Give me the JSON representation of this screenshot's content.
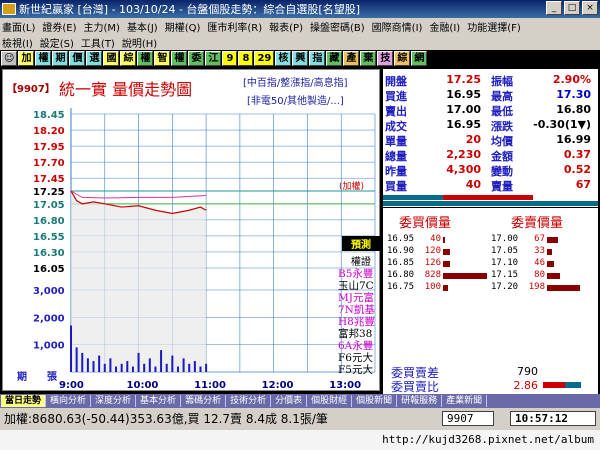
{
  "window": {
    "title": "新世紀贏家 [台灣] - 103/10/24 - 台盤個股走勢：綜合自選股[名望股]",
    "buttons": [
      "_",
      "□",
      "×"
    ]
  },
  "menu": {
    "row1": [
      "畫面(L)",
      "證券(E)",
      "主力(M)",
      "基本(J)",
      "期權(Q)",
      "匯市利率(R)",
      "報表(P)",
      "操盤密碼(B)",
      "國際商情(I)",
      "金融(I)",
      "功能選擇(F)"
    ],
    "row2": [
      "檢視(I)",
      "設定(S)",
      "工具(T)",
      "說明(H)"
    ]
  },
  "toolbar": {
    "buttons": [
      "☺",
      "加",
      "權",
      "期",
      "價",
      "選",
      "國",
      "綜",
      "權",
      "智",
      "權",
      "委",
      "江",
      "9",
      "8",
      "29",
      "核",
      "興",
      "指",
      "藏",
      "產",
      "棄",
      "技",
      "綜",
      "網"
    ]
  },
  "chart": {
    "stock_code": "【9907】",
    "title": "統一實  量價走勢圖",
    "sub1": "[中百指/整漲指/高息指]",
    "sub2": "[非電50/其他製造/...]",
    "annotation": "(加權)",
    "volume_axis_label": "張",
    "period_label": "期",
    "price_ticks": [
      "18.45",
      "18.20",
      "17.95",
      "17.70",
      "17.45",
      "17.25",
      "17.05",
      "16.80",
      "16.55",
      "16.30",
      "16.05"
    ],
    "volume_ticks": [
      "3,000",
      "2,000",
      "1,000"
    ],
    "time_ticks": [
      "9:00",
      "10:00",
      "11:00",
      "12:00",
      "13:00"
    ]
  },
  "chart_data": {
    "type": "line",
    "title": "統一實  量價走勢圖",
    "ylim": [
      16.05,
      18.45
    ],
    "reference_price": 17.25,
    "price_series": [
      {
        "t": "9:00",
        "v": 17.25
      },
      {
        "t": "9:05",
        "v": 17.1
      },
      {
        "t": "9:10",
        "v": 17.05
      },
      {
        "t": "9:20",
        "v": 17.08
      },
      {
        "t": "9:30",
        "v": 17.05
      },
      {
        "t": "9:45",
        "v": 17.0
      },
      {
        "t": "10:00",
        "v": 17.02
      },
      {
        "t": "10:15",
        "v": 16.95
      },
      {
        "t": "10:30",
        "v": 16.9
      },
      {
        "t": "10:45",
        "v": 16.95
      },
      {
        "t": "10:55",
        "v": 17.0
      },
      {
        "t": "11:00",
        "v": 16.95
      }
    ],
    "index_series": [
      {
        "t": "9:00",
        "v": 17.25
      },
      {
        "t": "9:10",
        "v": 17.15
      },
      {
        "t": "9:30",
        "v": 17.14
      },
      {
        "t": "10:00",
        "v": 17.15
      },
      {
        "t": "10:30",
        "v": 17.15
      },
      {
        "t": "11:00",
        "v": 17.18
      }
    ],
    "volume": [
      {
        "t": "9:00",
        "v": 1700
      },
      {
        "t": "9:05",
        "v": 900
      },
      {
        "t": "9:10",
        "v": 700
      },
      {
        "t": "9:15",
        "v": 500
      },
      {
        "t": "9:20",
        "v": 400
      },
      {
        "t": "9:25",
        "v": 600
      },
      {
        "t": "9:30",
        "v": 300
      },
      {
        "t": "9:35",
        "v": 500
      },
      {
        "t": "9:40",
        "v": 200
      },
      {
        "t": "9:45",
        "v": 300
      },
      {
        "t": "9:50",
        "v": 400
      },
      {
        "t": "9:55",
        "v": 200
      },
      {
        "t": "10:00",
        "v": 700
      },
      {
        "t": "10:05",
        "v": 300
      },
      {
        "t": "10:10",
        "v": 500
      },
      {
        "t": "10:15",
        "v": 200
      },
      {
        "t": "10:20",
        "v": 800
      },
      {
        "t": "10:25",
        "v": 300
      },
      {
        "t": "10:30",
        "v": 600
      },
      {
        "t": "10:35",
        "v": 200
      },
      {
        "t": "10:40",
        "v": 500
      },
      {
        "t": "10:45",
        "v": 300
      },
      {
        "t": "10:50",
        "v": 400
      },
      {
        "t": "10:55",
        "v": 200
      },
      {
        "t": "11:00",
        "v": 300
      }
    ],
    "vlim": [
      0,
      3000
    ],
    "time_range": [
      "9:00",
      "13:30"
    ],
    "grid": true
  },
  "quote": {
    "rows_left": [
      {
        "label": "開盤",
        "value": "17.25",
        "color": "#cc0000"
      },
      {
        "label": "買進",
        "value": "16.95",
        "color": "#000000"
      },
      {
        "label": "賣出",
        "value": "17.00",
        "color": "#000000"
      },
      {
        "label": "成交",
        "value": "16.95",
        "color": "#000000"
      },
      {
        "label": "單量",
        "value": "20",
        "color": "#cc0000"
      },
      {
        "label": "總量",
        "value": "2,230",
        "color": "#cc0000"
      },
      {
        "label": "昨量",
        "value": "4,300",
        "color": "#cc0000"
      },
      {
        "label": "買量",
        "value": "40",
        "color": "#cc0000"
      }
    ],
    "rows_right": [
      {
        "label": "振幅",
        "value": "2.90%",
        "color": "#cc0000"
      },
      {
        "label": "最高",
        "value": "17.30",
        "color": "#0000cc"
      },
      {
        "label": "最低",
        "value": "16.80",
        "color": "#000000"
      },
      {
        "label": "漲跌",
        "value": "-0.30(1▼)",
        "color": "#000000"
      },
      {
        "label": "均價",
        "value": "16.99",
        "color": "#000000"
      },
      {
        "label": "金額",
        "value": "0.37",
        "color": "#cc0000"
      },
      {
        "label": "變動",
        "value": "0.52",
        "color": "#cc0000"
      },
      {
        "label": "賣量",
        "value": "67",
        "color": "#cc0000"
      }
    ]
  },
  "book": {
    "bid_header": "委買價量",
    "ask_header": "委賣價量",
    "bids": [
      {
        "price": "16.95",
        "qty": "40",
        "pct": 0.05
      },
      {
        "price": "16.90",
        "qty": "120",
        "pct": 0.15
      },
      {
        "price": "16.85",
        "qty": "126",
        "pct": 0.15
      },
      {
        "price": "16.80",
        "qty": "828",
        "pct": 1.0
      },
      {
        "price": "16.75",
        "qty": "100",
        "pct": 0.12
      }
    ],
    "asks": [
      {
        "price": "17.00",
        "qty": "67",
        "pct": 0.25
      },
      {
        "price": "17.05",
        "qty": "33",
        "pct": 0.12
      },
      {
        "price": "17.10",
        "qty": "46",
        "pct": 0.17
      },
      {
        "price": "17.15",
        "qty": "80",
        "pct": 0.3
      },
      {
        "price": "17.20",
        "qty": "198",
        "pct": 0.75
      }
    ]
  },
  "summary": {
    "diff_label": "委買賣差",
    "diff_value": "790",
    "ratio_label": "委買賣比",
    "ratio_value": "2.86"
  },
  "brokers": {
    "header": "預測",
    "sub": "權證",
    "items": [
      {
        "name": "B5永豐",
        "color": "#cc00cc"
      },
      {
        "name": "玉山7C",
        "color": "#000000"
      },
      {
        "name": "MJ元富",
        "color": "#cc00cc"
      },
      {
        "name": "7N凱基",
        "color": "#cc00cc"
      },
      {
        "name": "H8兆豐",
        "color": "#cc00cc"
      },
      {
        "name": "富邦38",
        "color": "#000000"
      },
      {
        "name": "6A永豐",
        "color": "#cc00cc"
      },
      {
        "name": "F6元大",
        "color": "#000000"
      },
      {
        "name": "F5元大",
        "color": "#000000"
      }
    ]
  },
  "tabs": [
    "當日走勢",
    "橫向分析",
    "深度分析",
    "基本分析",
    "籌碼分析",
    "技術分析",
    "分價表",
    "個股財經",
    "個股新聞",
    "研報服務",
    "產業新聞"
  ],
  "status": {
    "text": "加權:8680.63(-50.44)353.63億,買 12.7賣 8.4成 8.1張/筆",
    "code": "9907",
    "time": "10:57:12"
  },
  "watermark": "http://kujd3268.pixnet.net/album"
}
